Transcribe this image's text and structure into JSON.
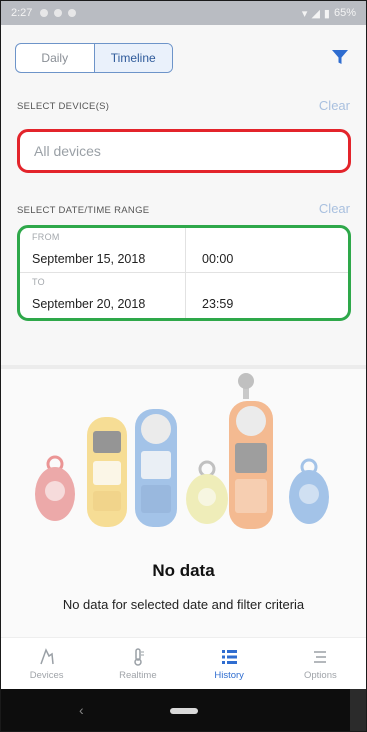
{
  "status_bar": {
    "time": "2:27",
    "battery": "65%"
  },
  "view_toggle": {
    "daily_label": "Daily",
    "timeline_label": "Timeline",
    "active": "timeline"
  },
  "device_section": {
    "label": "SELECT DEVICE(S)",
    "clear_label": "Clear",
    "field_value": "All devices"
  },
  "date_section": {
    "label": "SELECT DATE/TIME RANGE",
    "clear_label": "Clear",
    "from": {
      "caption": "FROM",
      "date": "September 15, 2018",
      "time": "00:00"
    },
    "to": {
      "caption": "TO",
      "date": "September 20, 2018",
      "time": "23:59"
    }
  },
  "empty_state": {
    "title": "No data",
    "message": "No data for selected date and filter criteria"
  },
  "nav": [
    {
      "label": "Devices",
      "icon": "devices-icon",
      "active": false
    },
    {
      "label": "Realtime",
      "icon": "thermometer-icon",
      "active": false
    },
    {
      "label": "History",
      "icon": "list-icon",
      "active": true
    },
    {
      "label": "Options",
      "icon": "menu-icon",
      "active": false
    }
  ],
  "colors": {
    "accent": "#2f6dd0",
    "device_highlight": "#e3242b",
    "date_highlight": "#2ea84a",
    "clear_link": "#a9c0df"
  }
}
